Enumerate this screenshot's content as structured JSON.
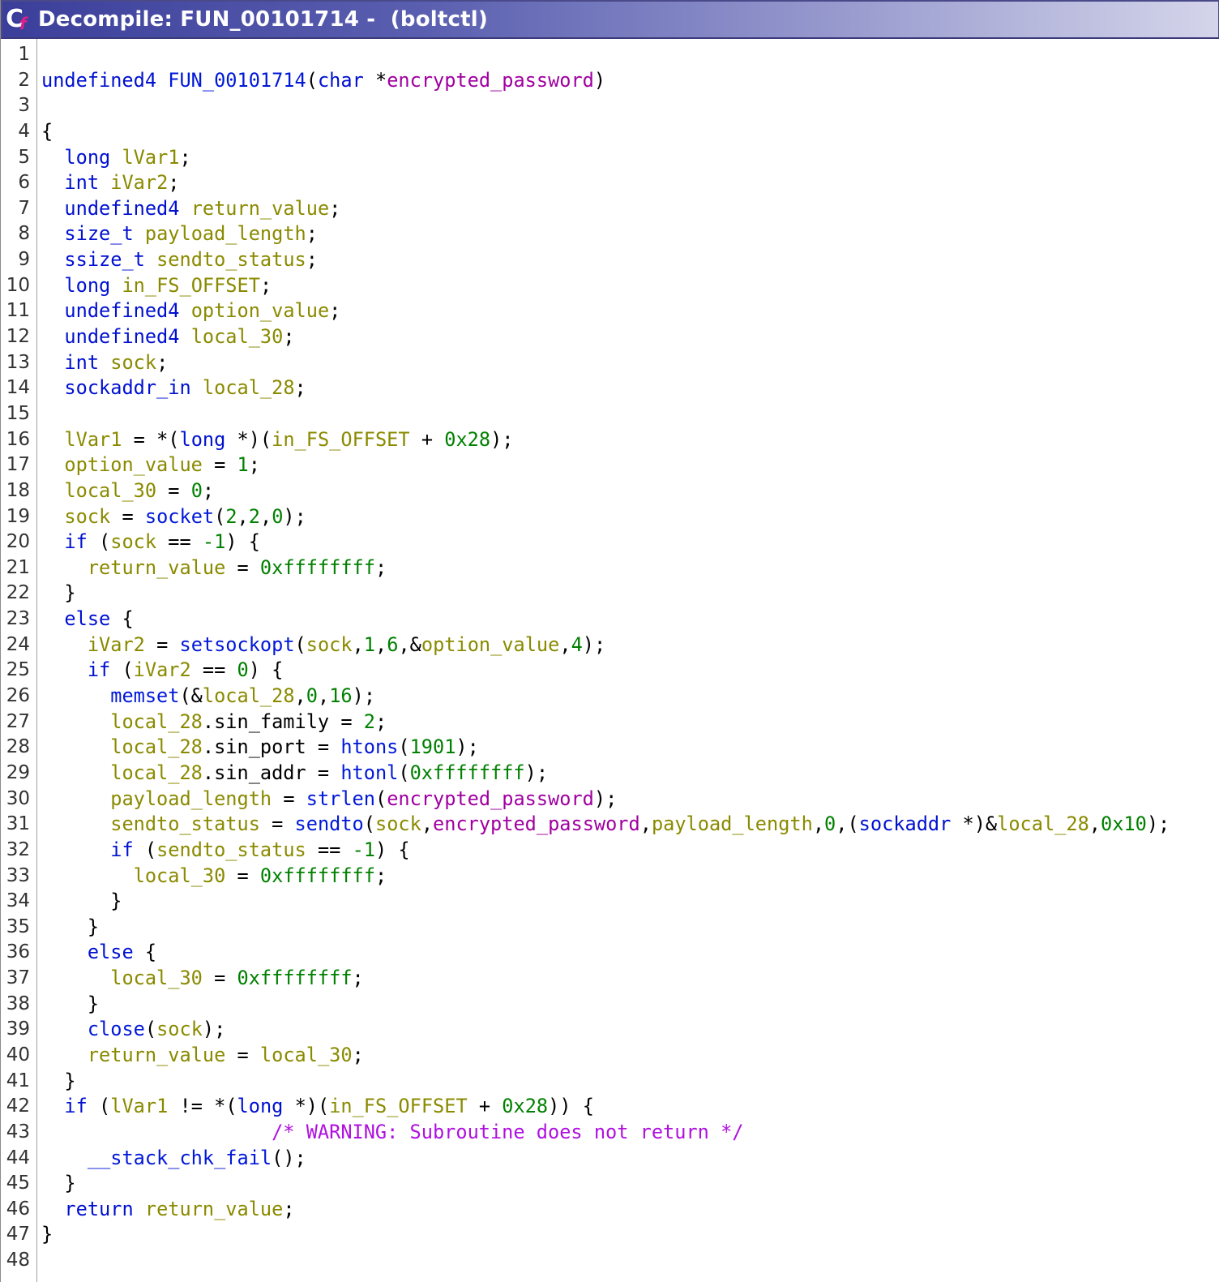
{
  "window": {
    "title": "Decompile: FUN_00101714 -  (boltctl)",
    "icon": "decompiler-icon"
  },
  "colors": {
    "keyword": "#0010d0",
    "function": "#0018d8",
    "variable": "#8a8a00",
    "parameter": "#a000a0",
    "constant": "#008000",
    "comment": "#b010e0",
    "plain": "#000000"
  },
  "code": {
    "lines": [
      {
        "n": "1",
        "indent": "",
        "tokens": []
      },
      {
        "n": "2",
        "indent": "",
        "tokens": [
          [
            "kw",
            "undefined4"
          ],
          [
            "pl",
            " "
          ],
          [
            "fn",
            "FUN_00101714"
          ],
          [
            "pl",
            "("
          ],
          [
            "kw",
            "char"
          ],
          [
            "pl",
            " *"
          ],
          [
            "par",
            "encrypted_password"
          ],
          [
            "pl",
            ")"
          ]
        ]
      },
      {
        "n": "3",
        "indent": "",
        "tokens": []
      },
      {
        "n": "4",
        "indent": "",
        "tokens": [
          [
            "pl",
            "{"
          ]
        ]
      },
      {
        "n": "5",
        "indent": "  ",
        "tokens": [
          [
            "kw",
            "long"
          ],
          [
            "pl",
            " "
          ],
          [
            "var",
            "lVar1"
          ],
          [
            "pl",
            ";"
          ]
        ]
      },
      {
        "n": "6",
        "indent": "  ",
        "tokens": [
          [
            "kw",
            "int"
          ],
          [
            "pl",
            " "
          ],
          [
            "var",
            "iVar2"
          ],
          [
            "pl",
            ";"
          ]
        ]
      },
      {
        "n": "7",
        "indent": "  ",
        "tokens": [
          [
            "kw",
            "undefined4"
          ],
          [
            "pl",
            " "
          ],
          [
            "var",
            "return_value"
          ],
          [
            "pl",
            ";"
          ]
        ]
      },
      {
        "n": "8",
        "indent": "  ",
        "tokens": [
          [
            "kw",
            "size_t"
          ],
          [
            "pl",
            " "
          ],
          [
            "var",
            "payload_length"
          ],
          [
            "pl",
            ";"
          ]
        ]
      },
      {
        "n": "9",
        "indent": "  ",
        "tokens": [
          [
            "kw",
            "ssize_t"
          ],
          [
            "pl",
            " "
          ],
          [
            "var",
            "sendto_status"
          ],
          [
            "pl",
            ";"
          ]
        ]
      },
      {
        "n": "10",
        "indent": "  ",
        "tokens": [
          [
            "kw",
            "long"
          ],
          [
            "pl",
            " "
          ],
          [
            "var",
            "in_FS_OFFSET"
          ],
          [
            "pl",
            ";"
          ]
        ]
      },
      {
        "n": "11",
        "indent": "  ",
        "tokens": [
          [
            "kw",
            "undefined4"
          ],
          [
            "pl",
            " "
          ],
          [
            "var",
            "option_value"
          ],
          [
            "pl",
            ";"
          ]
        ]
      },
      {
        "n": "12",
        "indent": "  ",
        "tokens": [
          [
            "kw",
            "undefined4"
          ],
          [
            "pl",
            " "
          ],
          [
            "var",
            "local_30"
          ],
          [
            "pl",
            ";"
          ]
        ]
      },
      {
        "n": "13",
        "indent": "  ",
        "tokens": [
          [
            "kw",
            "int"
          ],
          [
            "pl",
            " "
          ],
          [
            "var",
            "sock"
          ],
          [
            "pl",
            ";"
          ]
        ]
      },
      {
        "n": "14",
        "indent": "  ",
        "tokens": [
          [
            "kw",
            "sockaddr_in"
          ],
          [
            "pl",
            " "
          ],
          [
            "var",
            "local_28"
          ],
          [
            "pl",
            ";"
          ]
        ]
      },
      {
        "n": "15",
        "indent": "",
        "tokens": []
      },
      {
        "n": "16",
        "indent": "  ",
        "tokens": [
          [
            "var",
            "lVar1"
          ],
          [
            "pl",
            " = *("
          ],
          [
            "kw",
            "long"
          ],
          [
            "pl",
            " *)("
          ],
          [
            "var",
            "in_FS_OFFSET"
          ],
          [
            "pl",
            " + "
          ],
          [
            "num",
            "0x28"
          ],
          [
            "pl",
            ");"
          ]
        ]
      },
      {
        "n": "17",
        "indent": "  ",
        "tokens": [
          [
            "var",
            "option_value"
          ],
          [
            "pl",
            " = "
          ],
          [
            "num",
            "1"
          ],
          [
            "pl",
            ";"
          ]
        ]
      },
      {
        "n": "18",
        "indent": "  ",
        "tokens": [
          [
            "var",
            "local_30"
          ],
          [
            "pl",
            " = "
          ],
          [
            "num",
            "0"
          ],
          [
            "pl",
            ";"
          ]
        ]
      },
      {
        "n": "19",
        "indent": "  ",
        "tokens": [
          [
            "var",
            "sock"
          ],
          [
            "pl",
            " = "
          ],
          [
            "fn",
            "socket"
          ],
          [
            "pl",
            "("
          ],
          [
            "num",
            "2"
          ],
          [
            "pl",
            ","
          ],
          [
            "num",
            "2"
          ],
          [
            "pl",
            ","
          ],
          [
            "num",
            "0"
          ],
          [
            "pl",
            ");"
          ]
        ]
      },
      {
        "n": "20",
        "indent": "  ",
        "tokens": [
          [
            "kw",
            "if"
          ],
          [
            "pl",
            " ("
          ],
          [
            "var",
            "sock"
          ],
          [
            "pl",
            " == "
          ],
          [
            "num",
            "-1"
          ],
          [
            "pl",
            ") {"
          ]
        ]
      },
      {
        "n": "21",
        "indent": "    ",
        "tokens": [
          [
            "var",
            "return_value"
          ],
          [
            "pl",
            " = "
          ],
          [
            "num",
            "0xffffffff"
          ],
          [
            "pl",
            ";"
          ]
        ]
      },
      {
        "n": "22",
        "indent": "  ",
        "tokens": [
          [
            "pl",
            "}"
          ]
        ]
      },
      {
        "n": "23",
        "indent": "  ",
        "tokens": [
          [
            "kw",
            "else"
          ],
          [
            "pl",
            " {"
          ]
        ]
      },
      {
        "n": "24",
        "indent": "    ",
        "tokens": [
          [
            "var",
            "iVar2"
          ],
          [
            "pl",
            " = "
          ],
          [
            "fn",
            "setsockopt"
          ],
          [
            "pl",
            "("
          ],
          [
            "var",
            "sock"
          ],
          [
            "pl",
            ","
          ],
          [
            "num",
            "1"
          ],
          [
            "pl",
            ","
          ],
          [
            "num",
            "6"
          ],
          [
            "pl",
            ",&"
          ],
          [
            "var",
            "option_value"
          ],
          [
            "pl",
            ","
          ],
          [
            "num",
            "4"
          ],
          [
            "pl",
            ");"
          ]
        ]
      },
      {
        "n": "25",
        "indent": "    ",
        "tokens": [
          [
            "kw",
            "if"
          ],
          [
            "pl",
            " ("
          ],
          [
            "var",
            "iVar2"
          ],
          [
            "pl",
            " == "
          ],
          [
            "num",
            "0"
          ],
          [
            "pl",
            ") {"
          ]
        ]
      },
      {
        "n": "26",
        "indent": "      ",
        "tokens": [
          [
            "fn",
            "memset"
          ],
          [
            "pl",
            "(&"
          ],
          [
            "var",
            "local_28"
          ],
          [
            "pl",
            ","
          ],
          [
            "num",
            "0"
          ],
          [
            "pl",
            ","
          ],
          [
            "num",
            "16"
          ],
          [
            "pl",
            ");"
          ]
        ]
      },
      {
        "n": "27",
        "indent": "      ",
        "tokens": [
          [
            "var",
            "local_28"
          ],
          [
            "pl",
            ".sin_family = "
          ],
          [
            "num",
            "2"
          ],
          [
            "pl",
            ";"
          ]
        ]
      },
      {
        "n": "28",
        "indent": "      ",
        "tokens": [
          [
            "var",
            "local_28"
          ],
          [
            "pl",
            ".sin_port = "
          ],
          [
            "fn",
            "htons"
          ],
          [
            "pl",
            "("
          ],
          [
            "num",
            "1901"
          ],
          [
            "pl",
            ");"
          ]
        ]
      },
      {
        "n": "29",
        "indent": "      ",
        "tokens": [
          [
            "var",
            "local_28"
          ],
          [
            "pl",
            ".sin_addr = "
          ],
          [
            "fn",
            "htonl"
          ],
          [
            "pl",
            "("
          ],
          [
            "num",
            "0xffffffff"
          ],
          [
            "pl",
            ");"
          ]
        ]
      },
      {
        "n": "30",
        "indent": "      ",
        "tokens": [
          [
            "var",
            "payload_length"
          ],
          [
            "pl",
            " = "
          ],
          [
            "fn",
            "strlen"
          ],
          [
            "pl",
            "("
          ],
          [
            "par",
            "encrypted_password"
          ],
          [
            "pl",
            ");"
          ]
        ]
      },
      {
        "n": "31",
        "indent": "      ",
        "tokens": [
          [
            "var",
            "sendto_status"
          ],
          [
            "pl",
            " = "
          ],
          [
            "fn",
            "sendto"
          ],
          [
            "pl",
            "("
          ],
          [
            "var",
            "sock"
          ],
          [
            "pl",
            ","
          ],
          [
            "par",
            "encrypted_password"
          ],
          [
            "pl",
            ","
          ],
          [
            "var",
            "payload_length"
          ],
          [
            "pl",
            ","
          ],
          [
            "num",
            "0"
          ],
          [
            "pl",
            ",("
          ],
          [
            "kw",
            "sockaddr"
          ],
          [
            "pl",
            " *)&"
          ],
          [
            "var",
            "local_28"
          ],
          [
            "pl",
            ","
          ],
          [
            "num",
            "0x10"
          ],
          [
            "pl",
            ");"
          ]
        ]
      },
      {
        "n": "32",
        "indent": "      ",
        "tokens": [
          [
            "kw",
            "if"
          ],
          [
            "pl",
            " ("
          ],
          [
            "var",
            "sendto_status"
          ],
          [
            "pl",
            " == "
          ],
          [
            "num",
            "-1"
          ],
          [
            "pl",
            ") {"
          ]
        ]
      },
      {
        "n": "33",
        "indent": "        ",
        "tokens": [
          [
            "var",
            "local_30"
          ],
          [
            "pl",
            " = "
          ],
          [
            "num",
            "0xffffffff"
          ],
          [
            "pl",
            ";"
          ]
        ]
      },
      {
        "n": "34",
        "indent": "      ",
        "tokens": [
          [
            "pl",
            "}"
          ]
        ]
      },
      {
        "n": "35",
        "indent": "    ",
        "tokens": [
          [
            "pl",
            "}"
          ]
        ]
      },
      {
        "n": "36",
        "indent": "    ",
        "tokens": [
          [
            "kw",
            "else"
          ],
          [
            "pl",
            " {"
          ]
        ]
      },
      {
        "n": "37",
        "indent": "      ",
        "tokens": [
          [
            "var",
            "local_30"
          ],
          [
            "pl",
            " = "
          ],
          [
            "num",
            "0xffffffff"
          ],
          [
            "pl",
            ";"
          ]
        ]
      },
      {
        "n": "38",
        "indent": "    ",
        "tokens": [
          [
            "pl",
            "}"
          ]
        ]
      },
      {
        "n": "39",
        "indent": "    ",
        "tokens": [
          [
            "fn",
            "close"
          ],
          [
            "pl",
            "("
          ],
          [
            "var",
            "sock"
          ],
          [
            "pl",
            ");"
          ]
        ]
      },
      {
        "n": "40",
        "indent": "    ",
        "tokens": [
          [
            "var",
            "return_value"
          ],
          [
            "pl",
            " = "
          ],
          [
            "var",
            "local_30"
          ],
          [
            "pl",
            ";"
          ]
        ]
      },
      {
        "n": "41",
        "indent": "  ",
        "tokens": [
          [
            "pl",
            "}"
          ]
        ]
      },
      {
        "n": "42",
        "indent": "  ",
        "tokens": [
          [
            "kw",
            "if"
          ],
          [
            "pl",
            " ("
          ],
          [
            "var",
            "lVar1"
          ],
          [
            "pl",
            " != *("
          ],
          [
            "kw",
            "long"
          ],
          [
            "pl",
            " *)("
          ],
          [
            "var",
            "in_FS_OFFSET"
          ],
          [
            "pl",
            " + "
          ],
          [
            "num",
            "0x28"
          ],
          [
            "pl",
            ")) {"
          ]
        ]
      },
      {
        "n": "43",
        "indent": "                    ",
        "tokens": [
          [
            "cm",
            "/* WARNING: Subroutine does not return */"
          ]
        ]
      },
      {
        "n": "44",
        "indent": "    ",
        "tokens": [
          [
            "fn",
            "__stack_chk_fail"
          ],
          [
            "pl",
            "();"
          ]
        ]
      },
      {
        "n": "45",
        "indent": "  ",
        "tokens": [
          [
            "pl",
            "}"
          ]
        ]
      },
      {
        "n": "46",
        "indent": "  ",
        "tokens": [
          [
            "kw",
            "return"
          ],
          [
            "pl",
            " "
          ],
          [
            "var",
            "return_value"
          ],
          [
            "pl",
            ";"
          ]
        ]
      },
      {
        "n": "47",
        "indent": "",
        "tokens": [
          [
            "pl",
            "}"
          ]
        ]
      },
      {
        "n": "48",
        "indent": "",
        "tokens": []
      }
    ]
  }
}
